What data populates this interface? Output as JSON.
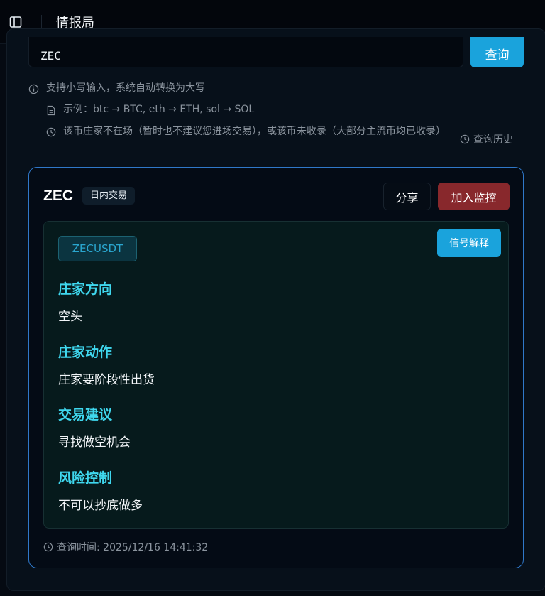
{
  "app": {
    "title": "情报局"
  },
  "search": {
    "value": "ZEC",
    "button_label": "查询"
  },
  "hints": {
    "lowercase": "支持小写输入，系统自动转换为大写",
    "example": "示例：btc → BTC, eth → ETH, sol → SOL",
    "status": "该币庄家不在场（暂时也不建议您进场交易），或该币未收录（大部分主流币均已收录）",
    "history_label": "查询历史"
  },
  "result": {
    "symbol": "ZEC",
    "mode": "日内交易",
    "share_label": "分享",
    "monitor_label": "加入监控",
    "pair": "ZECUSDT",
    "explain_label": "信号解释",
    "sections": [
      {
        "heading": "庄家方向",
        "value": "空头"
      },
      {
        "heading": "庄家动作",
        "value": "庄家要阶段性出货"
      },
      {
        "heading": "交易建议",
        "value": "寻找做空机会"
      },
      {
        "heading": "风险控制",
        "value": "不可以抄底做多"
      }
    ],
    "query_time": "查询时间: 2025/12/16 14:41:32"
  },
  "colors": {
    "accent": "#1aa3dc",
    "danger": "#88282c",
    "heading": "#3fd7ee",
    "card_border": "#2f78c9"
  }
}
